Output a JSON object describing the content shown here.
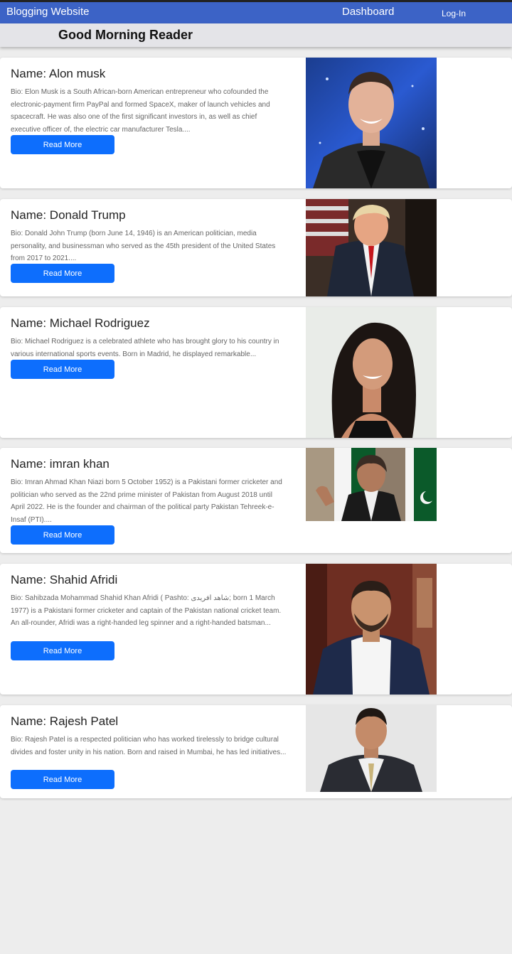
{
  "navbar": {
    "brand": "Blogging Website",
    "dashboard": "Dashboard",
    "login": "Log-In"
  },
  "greeting": "Good Morning Reader",
  "cards": [
    {
      "name": "Name: Alon musk",
      "bio": "Bio: Elon Musk is a South African-born American entrepreneur who cofounded the electronic-payment firm PayPal and formed SpaceX, maker of launch vehicles and spacecraft. He was also one of the first significant investors in, as well as chief executive officer of, the electric car manufacturer Tesla....",
      "button": "Read More"
    },
    {
      "name": "Name: Donald Trump",
      "bio": "Bio: Donald John Trump (born June 14, 1946) is an American politician, media personality, and businessman who served as the 45th president of the United States from 2017 to 2021....",
      "button": "Read More"
    },
    {
      "name": "Name: Michael Rodriguez",
      "bio": "Bio: Michael Rodriguez is a celebrated athlete who has brought glory to his country in various international sports events. Born in Madrid, he displayed remarkable...",
      "button": "Read More"
    },
    {
      "name": "Name: imran khan",
      "bio": "Bio: Imran Ahmad Khan Niazi born 5 October 1952) is a Pakistani former cricketer and politician who served as the 22nd prime minister of Pakistan from August 2018 until April 2022. He is the founder and chairman of the political party Pakistan Tehreek-e-Insaf (PTI)....",
      "button": "Read More"
    },
    {
      "name": "Name: Shahid Afridi",
      "bio": "Bio: Sahibzada Mohammad Shahid Khan Afridi ( Pashto: شاهد افریدی; born 1 March 1977) is a Pakistani former cricketer and captain of the Pakistan national cricket team. An all-rounder, Afridi was a right-handed leg spinner and a right-handed batsman...",
      "button": "Read More"
    },
    {
      "name": "Name: Rajesh Patel",
      "bio": "Bio: Rajesh Patel is a respected politician who has worked tirelessly to bridge cultural divides and foster unity in his nation. Born and raised in Mumbai, he has led initiatives...",
      "button": "Read More"
    }
  ],
  "colors": {
    "navbar": "#3c63c6",
    "button": "#0d6efd",
    "page_background": "#ededed"
  }
}
